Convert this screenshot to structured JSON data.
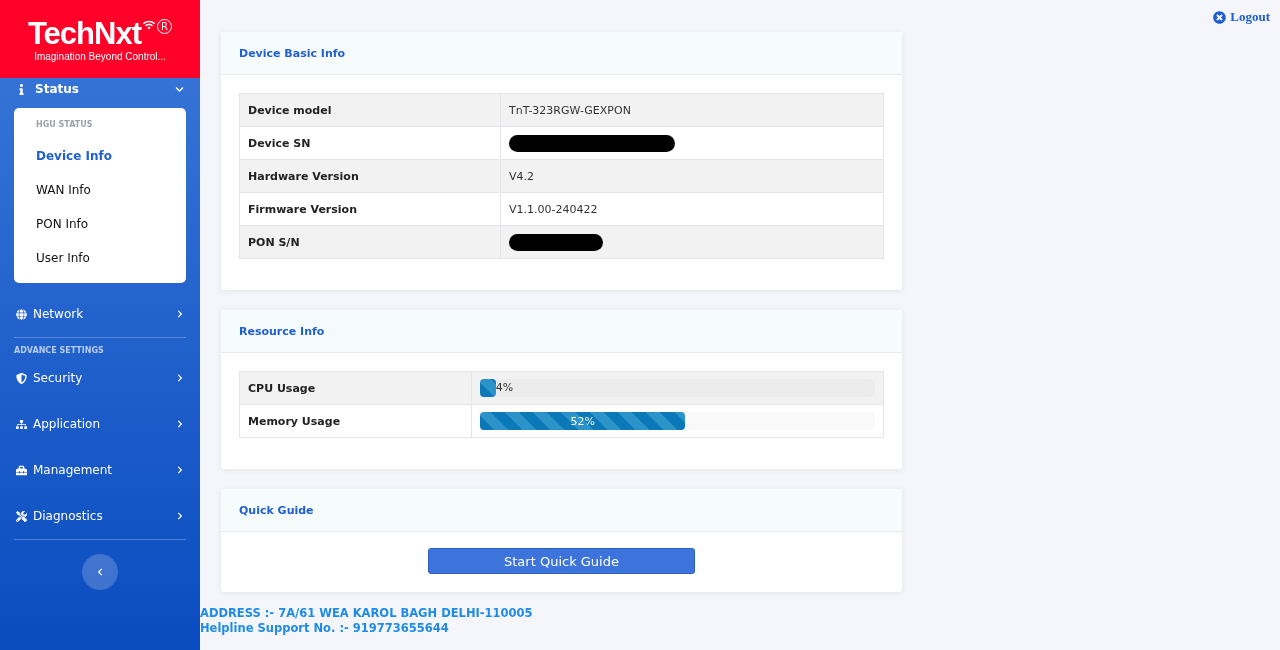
{
  "logo": {
    "name": "TechNxt",
    "mark": "R",
    "tagline": "Imagination Beyond Control..."
  },
  "sidebar": {
    "status": {
      "label": "Status",
      "expanded": true,
      "group_title": "HGU STATUS",
      "items": [
        {
          "label": "Device Info",
          "selected": true
        },
        {
          "label": "WAN Info",
          "selected": false
        },
        {
          "label": "PON Info",
          "selected": false
        },
        {
          "label": "User Info",
          "selected": false
        }
      ]
    },
    "network": {
      "label": "Network"
    },
    "section_title": "ADVANCE SETTINGS",
    "items": [
      {
        "label": "Security"
      },
      {
        "label": "Application"
      },
      {
        "label": "Management"
      },
      {
        "label": "Diagnostics"
      }
    ]
  },
  "logout": "Logout",
  "device_basic_info": {
    "title": "Device Basic Info",
    "rows": [
      {
        "label": "Device model",
        "value": "TnT-323RGW-GEXPON",
        "redacted": false
      },
      {
        "label": "Device SN",
        "redacted": true
      },
      {
        "label": "Hardware Version",
        "value": "V4.2",
        "redacted": false
      },
      {
        "label": "Firmware Version",
        "value": "V1.1.00-240422",
        "redacted": false
      },
      {
        "label": "PON S/N",
        "redacted": true
      }
    ]
  },
  "resource_info": {
    "title": "Resource Info",
    "rows": [
      {
        "label": "CPU Usage",
        "level": 0.04,
        "reading": "4%"
      },
      {
        "label": "Memory Usage",
        "level": 0.52,
        "reading": "52%"
      }
    ]
  },
  "quick_guide": {
    "title": "Quick Guide",
    "button": "Start Quick Guide"
  },
  "footer": {
    "address": "ADDRESS :- 7A/61 WEA KAROL BAGH DELHI-110005",
    "helpline": "Helpline Support No. :- 919773655644"
  }
}
